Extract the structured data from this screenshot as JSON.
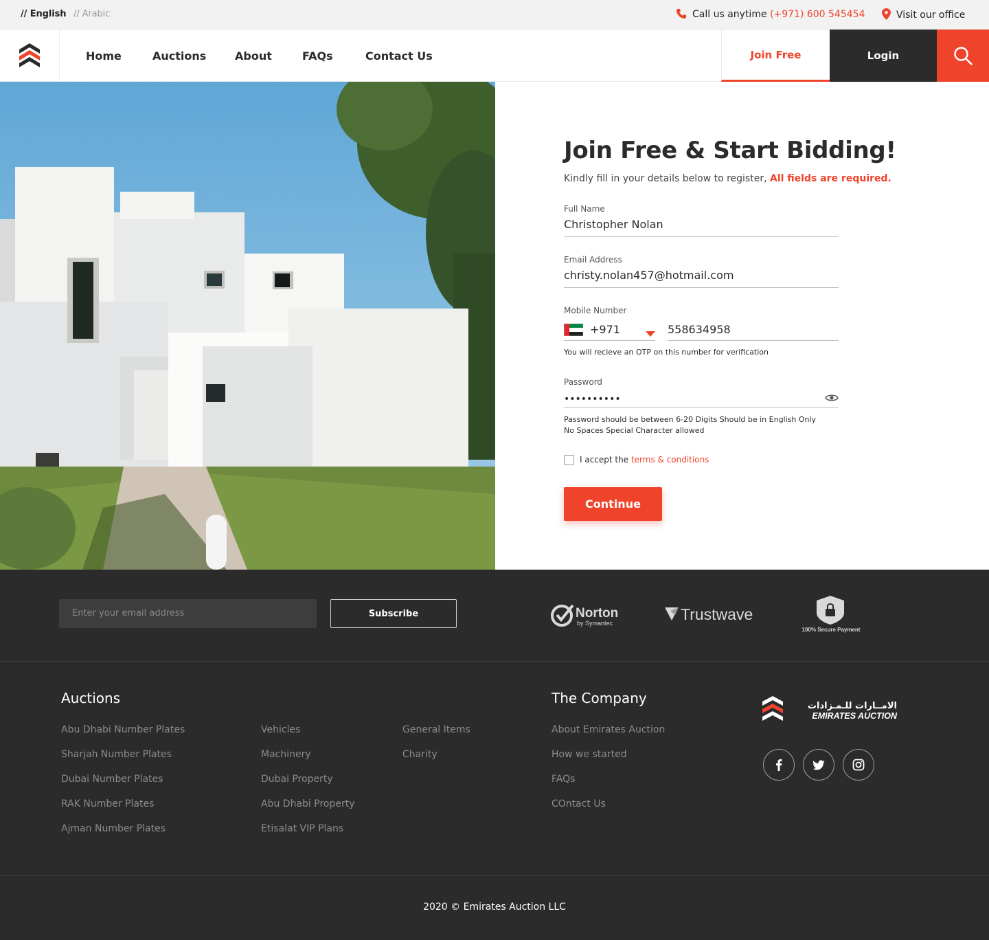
{
  "topbar": {
    "lang_english": "// English",
    "lang_arabic": "// Arabic",
    "call_label": "Call us anytime",
    "call_number": "(+971) 600 545454",
    "visit_label": "Visit our office"
  },
  "nav": {
    "items": [
      "Home",
      "Auctions",
      "About",
      "FAQs",
      "Contact Us"
    ],
    "join": "Join Free",
    "login": "Login"
  },
  "form": {
    "title": "Join Free & Start Bidding!",
    "subtitle": "Kindly fill in your details below to register,",
    "required": "All fields are required.",
    "fullname_label": "Full Name",
    "fullname_value": "Christopher Nolan",
    "email_label": "Email Address",
    "email_value": "christy.nolan457@hotmail.com",
    "mobile_label": "Mobile Number",
    "country_code": "+971",
    "mobile_value": "558634958",
    "otp_hint": "You will recieve an OTP on this number for verification",
    "password_label": "Password",
    "password_value": "••••••••••",
    "password_hint_1": "Password should be between 6-20 Digits Should be in English Only",
    "password_hint_2": "No Spaces Special Character allowed",
    "accept_text": "I accept the",
    "terms_link": "terms & conditions",
    "continue": "Continue"
  },
  "newsletter": {
    "email_placeholder": "Enter your email address",
    "subscribe": "Subscribe",
    "norton": "Norton",
    "norton_sub": "by Symantec",
    "trustwave": "Trustwave",
    "secure": "100% Secure Payment"
  },
  "footer": {
    "auctions_heading": "Auctions",
    "auctions_col1": [
      "Abu Dhabi Number Plates",
      "Sharjah Number Plates",
      "Dubai Number Plates",
      "RAK Number Plates",
      "Ajman Number Plates"
    ],
    "auctions_col2": [
      "Vehicles",
      "Machinery",
      "Dubai Property",
      "Abu Dhabi Property",
      "Etisalat VIP Plans"
    ],
    "auctions_col3": [
      "General Items",
      "Charity"
    ],
    "company_heading": "The Company",
    "company_links": [
      "About Emirates Auction",
      "How we started",
      "FAQs",
      "COntact Us"
    ],
    "brand_arabic": "الامــارات للـمـزادات",
    "brand_english": "EMIRATES AUCTION",
    "copyright": "2020 © Emirates Auction LLC"
  },
  "colors": {
    "accent": "#f0432b",
    "dark": "#2b2b2b"
  },
  "icons": [
    "phone-icon",
    "location-pin-icon",
    "logo-chevron-icon",
    "search-icon",
    "uae-flag-icon",
    "caret-down-icon",
    "eye-icon",
    "facebook-icon",
    "twitter-icon",
    "instagram-icon",
    "shield-lock-icon"
  ]
}
